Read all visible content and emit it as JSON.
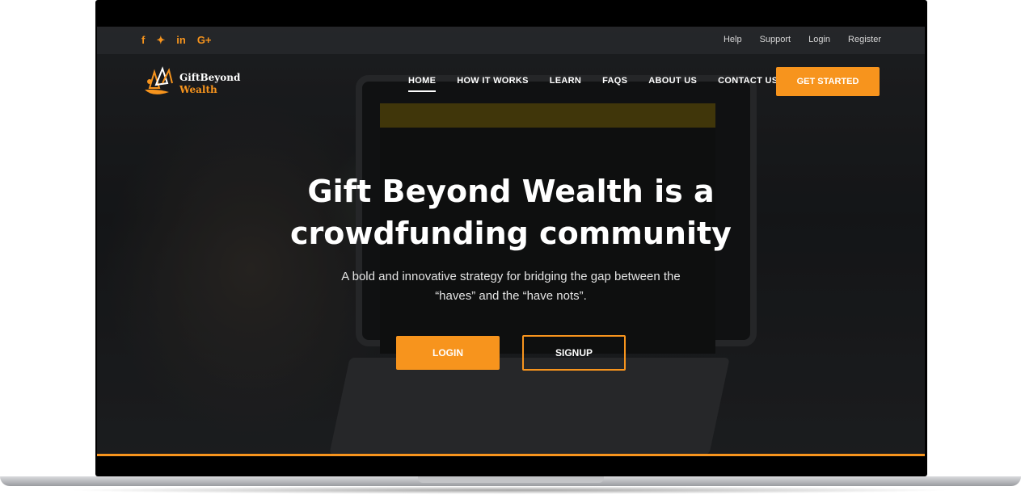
{
  "social": {
    "icons": [
      {
        "name": "facebook-icon",
        "glyph": "f"
      },
      {
        "name": "twitter-icon",
        "glyph": "✦"
      },
      {
        "name": "linkedin-icon",
        "glyph": "in"
      },
      {
        "name": "google-plus-icon",
        "glyph": "G+"
      }
    ]
  },
  "toplinks": [
    "Help",
    "Support",
    "Login",
    "Register"
  ],
  "logo": {
    "line1": "GiftBeyond",
    "line2": "Wealth"
  },
  "nav": {
    "items": [
      "HOME",
      "HOW IT WORKS",
      "LEARN",
      "FAQS",
      "ABOUT US",
      "CONTACT US"
    ],
    "cta": "GET STARTED"
  },
  "hero": {
    "title_line1": "Gift Beyond Wealth is a",
    "title_line2": "crowdfunding community",
    "subtitle": "A bold and innovative strategy for bridging the gap between the “haves” and the “have nots”.",
    "login": "LOGIN",
    "signup": "SIGNUP"
  },
  "colors": {
    "accent": "#f7941d",
    "bar": "#282a2d"
  }
}
